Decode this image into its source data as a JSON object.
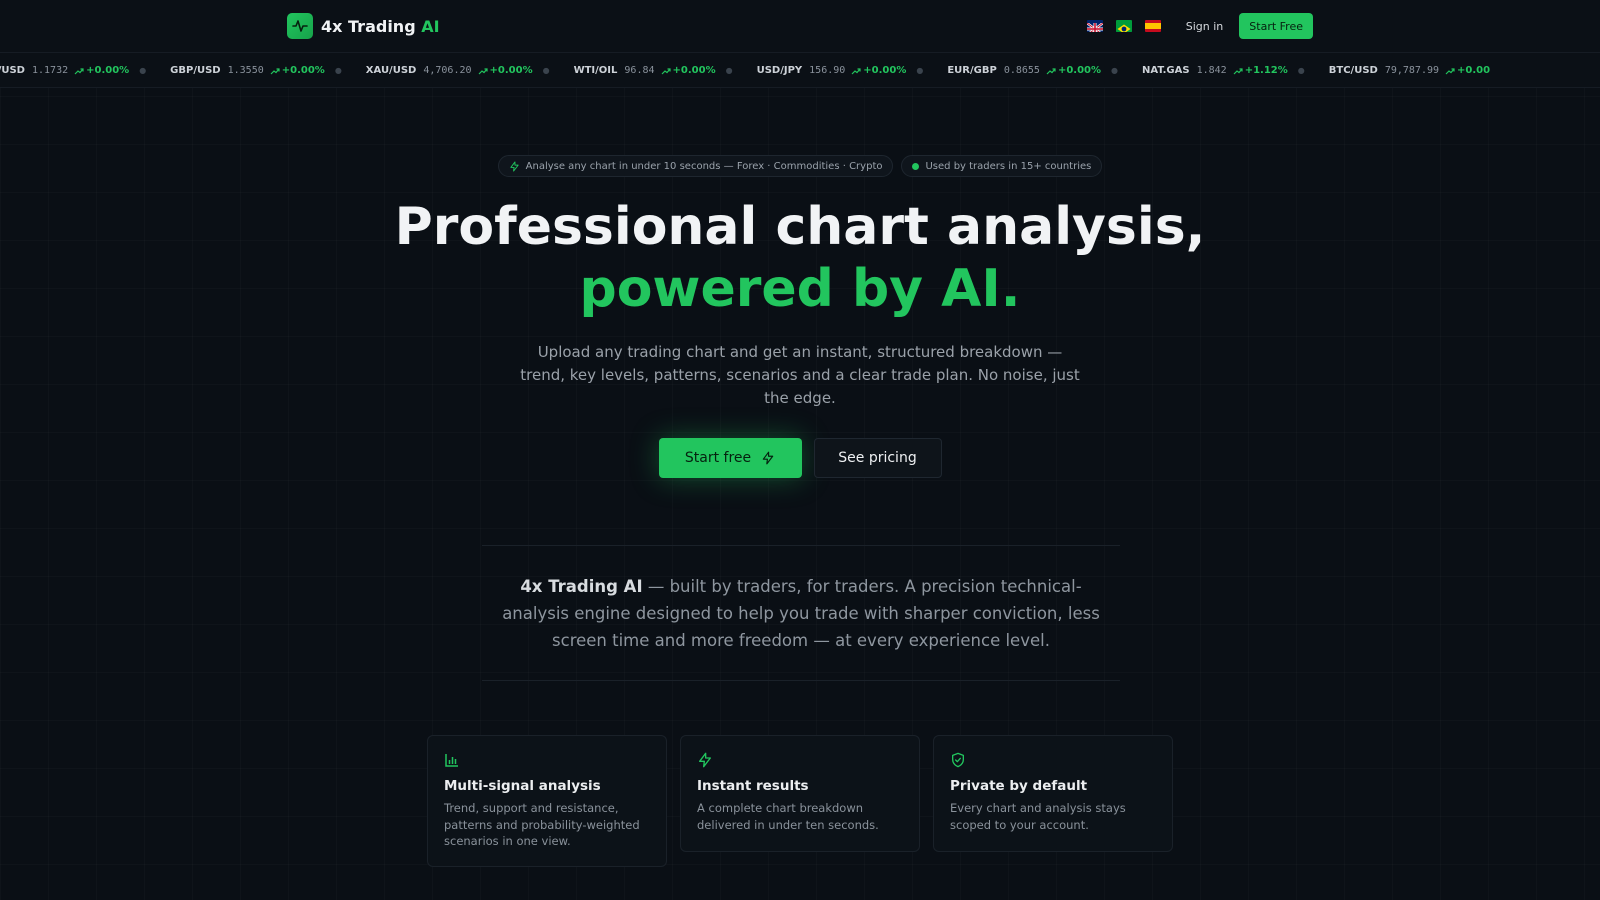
{
  "header": {
    "brand_main": "4x Trading",
    "brand_accent": "AI",
    "flags": [
      "uk-flag-icon",
      "brazil-flag-icon",
      "spain-flag-icon"
    ],
    "signin_label": "Sign in",
    "startfree_label": "Start Free"
  },
  "ticker": [
    {
      "symbol": "R/USD",
      "price": "1.1732",
      "change": "+0.00%"
    },
    {
      "symbol": "GBP/USD",
      "price": "1.3550",
      "change": "+0.00%"
    },
    {
      "symbol": "XAU/USD",
      "price": "4,706.20",
      "change": "+0.00%"
    },
    {
      "symbol": "WTI/OIL",
      "price": "96.84",
      "change": "+0.00%"
    },
    {
      "symbol": "USD/JPY",
      "price": "156.90",
      "change": "+0.00%"
    },
    {
      "symbol": "EUR/GBP",
      "price": "0.8655",
      "change": "+0.00%"
    },
    {
      "symbol": "NAT.GAS",
      "price": "1.842",
      "change": "+1.12%"
    },
    {
      "symbol": "BTC/USD",
      "price": "79,787.99",
      "change": "+0.00"
    }
  ],
  "hero": {
    "pill_left": "Analyse any chart in under 10 seconds — Forex · Commodities · Crypto",
    "pill_right": "Used by traders in 15+ countries",
    "title_line1": "Professional chart analysis,",
    "title_line2": "powered by AI.",
    "subtitle": "Upload any trading chart and get an instant, structured breakdown — trend, key levels, patterns, scenarios and a clear trade plan. No noise, just the edge.",
    "cta_primary": "Start free",
    "cta_secondary": "See pricing"
  },
  "about": {
    "brand": "4x Trading AI",
    "text": " — built by traders, for traders. A precision technical-analysis engine designed to help you trade with sharper conviction, less screen time and more freedom — at every experience level."
  },
  "features": [
    {
      "icon": "bar-chart-icon",
      "title": "Multi-signal analysis",
      "text": "Trend, support and resistance, patterns and probability-weighted scenarios in one view."
    },
    {
      "icon": "lightning-icon",
      "title": "Instant results",
      "text": "A complete chart breakdown delivered in under ten seconds."
    },
    {
      "icon": "shield-check-icon",
      "title": "Private by default",
      "text": "Every chart and analysis stays scoped to your account."
    }
  ],
  "colors": {
    "background": "#0a0f15",
    "accent": "#22c55e",
    "text": "#f1f3f5",
    "muted": "#9aa1a9"
  }
}
